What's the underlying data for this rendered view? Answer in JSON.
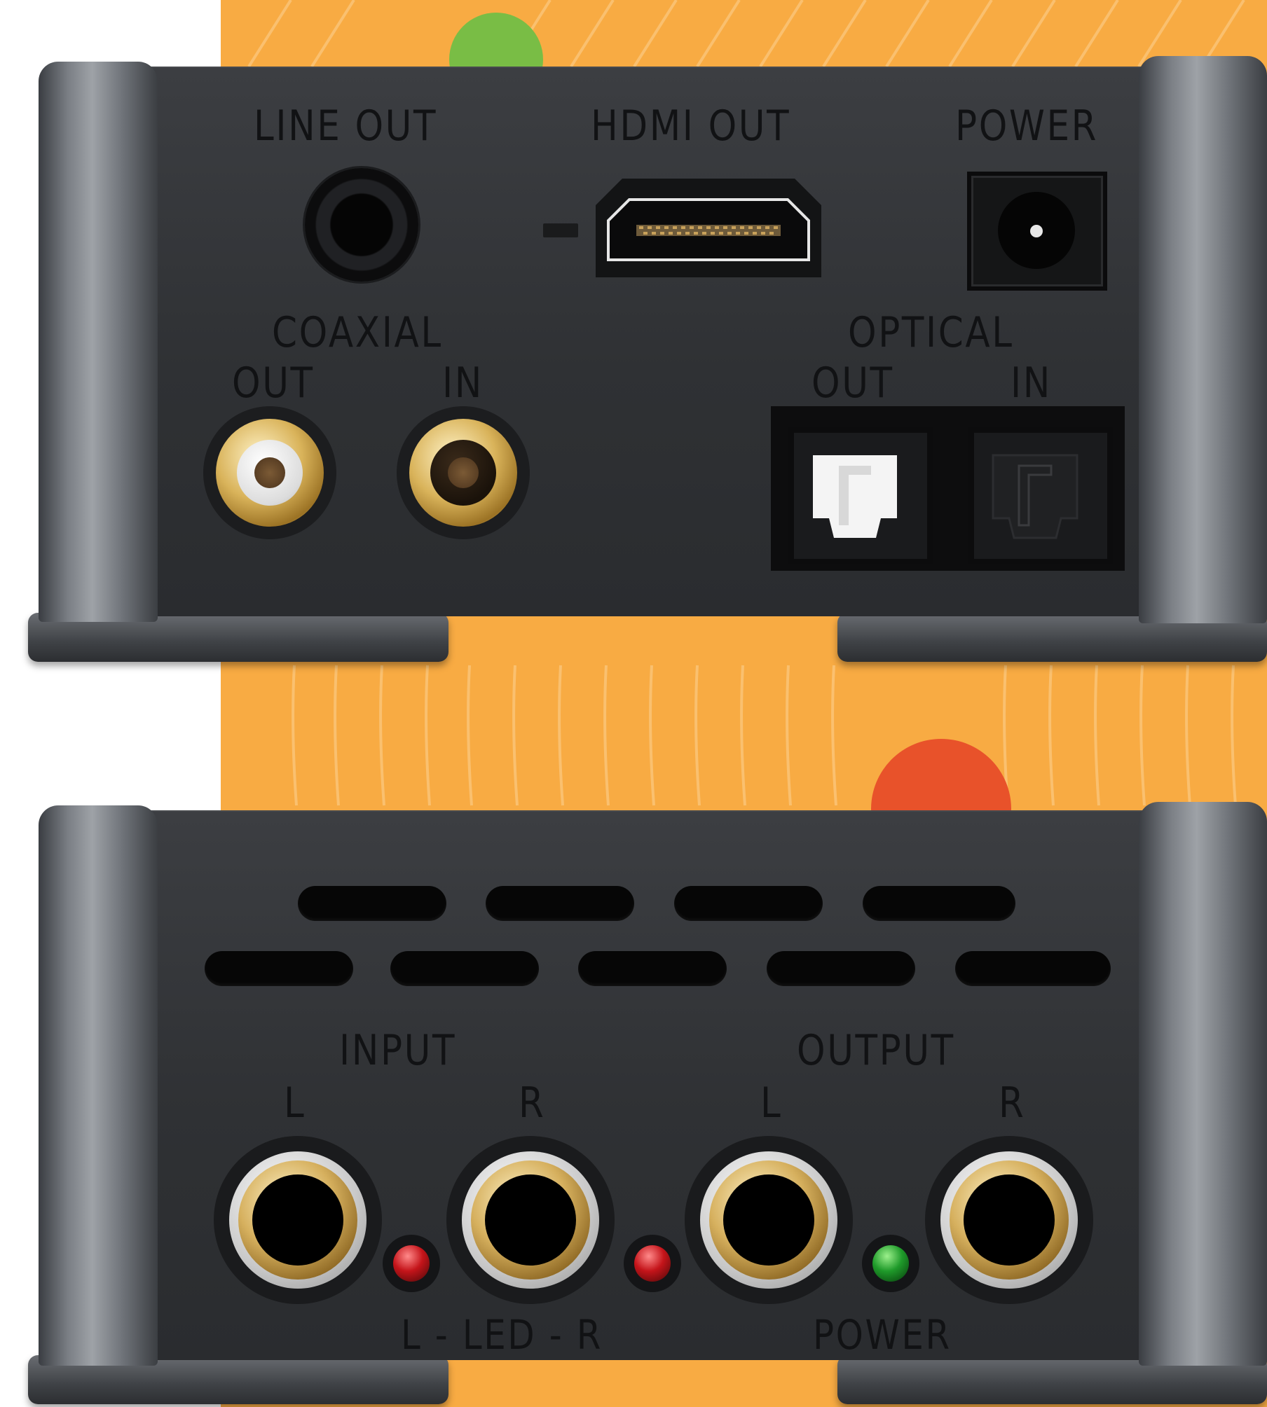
{
  "scene": {
    "background_color": "#f8ab43",
    "accent_colors": {
      "green_dot": "#79bd45",
      "red_dot": "#e8522a",
      "device_body": "#2f3134"
    }
  },
  "top_panel": {
    "line_out_label": "LINE OUT",
    "hdmi_out_label": "HDMI OUT",
    "power_label": "POWER",
    "coaxial_label": "COAXIAL",
    "coaxial_out_label": "OUT",
    "coaxial_in_label": "IN",
    "optical_label": "OPTICAL",
    "optical_out_label": "OUT",
    "optical_in_label": "IN",
    "hdmi_indicator": "–"
  },
  "bottom_panel": {
    "input_label": "INPUT",
    "output_label": "OUTPUT",
    "input_l": "L",
    "input_r": "R",
    "output_l": "L",
    "output_r": "R",
    "led_label": "L - LED - R",
    "power_label": "POWER"
  }
}
